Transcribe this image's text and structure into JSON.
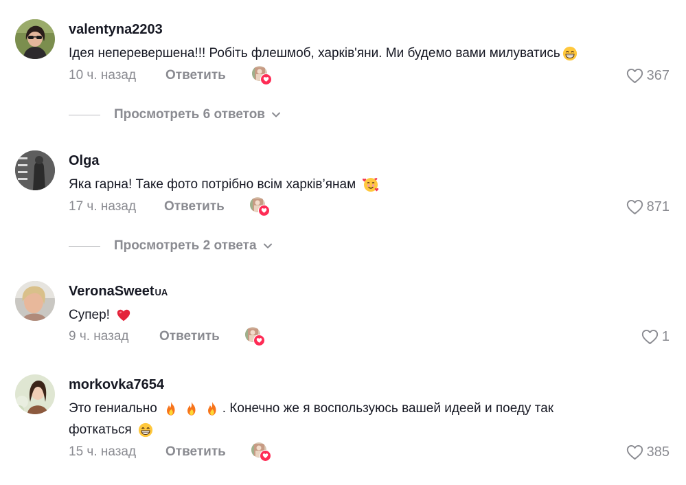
{
  "comments": [
    {
      "username": "valentyna2203",
      "text": "Ідея неперевершена!!! Робіть флешмоб, харків'яни. Ми будемо вами милуватись",
      "emoji_end": "grin",
      "time": "10 ч. назад",
      "reply_label": "Ответить",
      "likes": "367",
      "replies_label": "Просмотреть 6 ответов"
    },
    {
      "username": "Olga",
      "text": "Яка гарна! Таке фото потрібно всім харків’янам",
      "emoji_end": "smiling-hearts",
      "time": "17 ч. назад",
      "reply_label": "Ответить",
      "likes": "871",
      "replies_label": "Просмотреть 2 ответа"
    },
    {
      "username": "VeronaSweet",
      "username_suffix": "UA",
      "text": "Супер!",
      "emoji_end": "red-heart",
      "time": "9 ч. назад",
      "reply_label": "Ответить",
      "likes": "1"
    },
    {
      "username": "morkovka7654",
      "text_part1": "Это гениально",
      "text_part2": ". Конечно же я воспользуюсь вашей идеей и поеду так",
      "text_part3": "фоткаться",
      "emojis": [
        "fire",
        "fire",
        "fire",
        "grin"
      ],
      "time": "15 ч. назад",
      "reply_label": "Ответить",
      "likes": "385"
    }
  ],
  "colors": {
    "accent": "#fe2c55",
    "muted": "#8a8b91",
    "text": "#161823"
  }
}
